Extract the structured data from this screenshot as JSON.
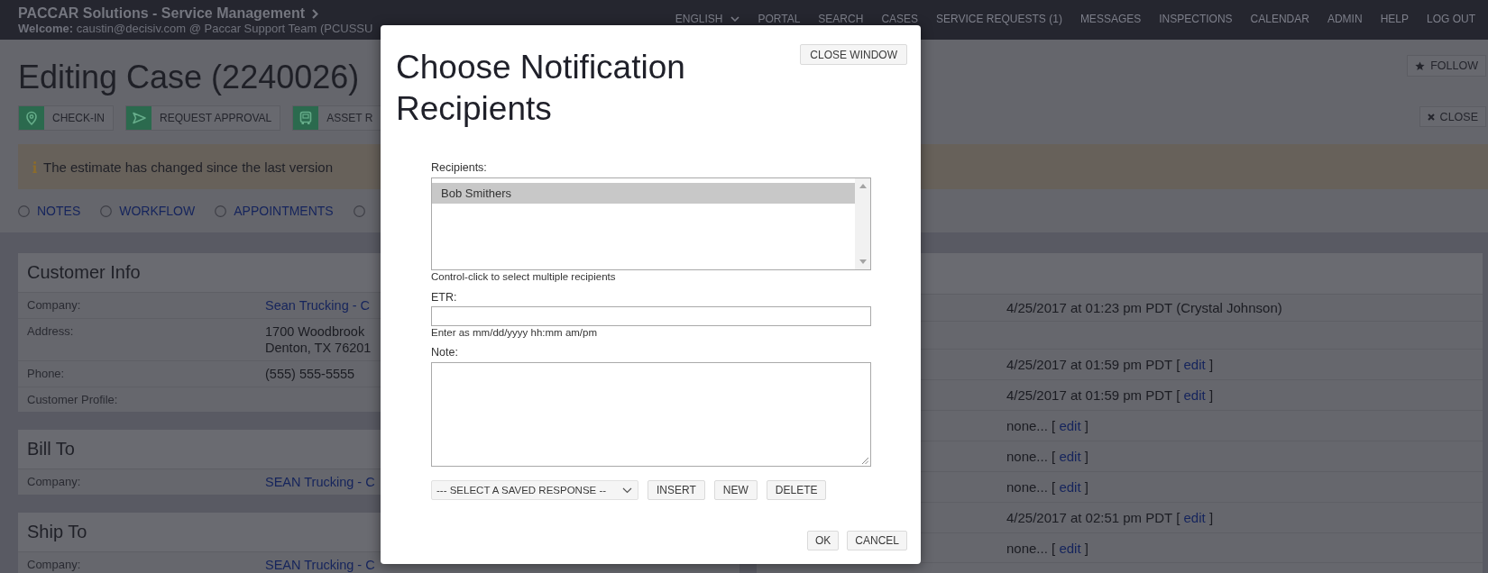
{
  "header": {
    "title": "PACCAR Solutions - Service Management",
    "welcome": "**Welcome:** caustin@decisiv.com @ Paccar Support Team (PCUSSU"
  },
  "nav": [
    {
      "label": "ENGLISH",
      "kind": "dropdown"
    },
    {
      "label": "PORTAL",
      "kind": "link"
    },
    {
      "label": "SEARCH",
      "kind": "link"
    },
    {
      "label": "CASES",
      "kind": "link"
    },
    {
      "label": "SERVICE REQUESTS (1)",
      "kind": "link"
    },
    {
      "label": "MESSAGES",
      "kind": "link"
    },
    {
      "label": "INSPECTIONS",
      "kind": "link"
    },
    {
      "label": "CALENDAR",
      "kind": "link"
    },
    {
      "label": "ADMIN",
      "kind": "link"
    },
    {
      "label": "HELP",
      "kind": "link"
    },
    {
      "label": "LOG OUT",
      "kind": "link"
    }
  ],
  "page": {
    "title": "Editing Case (2240026)",
    "actions": [
      "CHECK-IN",
      "REQUEST APPROVAL",
      "ASSET R"
    ],
    "follow_button": "FOLLOW",
    "close_button": "CLOSE"
  },
  "alert": {
    "text": "The estimate has changed since the last version"
  },
  "tabs": [
    {
      "label": "NOTES",
      "selected": false
    },
    {
      "label": "WORKFLOW",
      "selected": false
    },
    {
      "label": "APPOINTMENTS",
      "selected": false
    },
    {
      "selected": false
    }
  ],
  "panels": [
    {
      "title": "Customer Info",
      "rows": [
        {
          "label": "Company:",
          "kind": "link",
          "value": "Sean Trucking - C"
        },
        {
          "label": "Address:",
          "kind": "text",
          "value": "1700 Woodbrook\nDenton, TX 76201"
        },
        {
          "label": "Phone:",
          "kind": "text",
          "value": "(555) 555-5555"
        },
        {
          "label": "Customer Profile:",
          "kind": "text"
        }
      ]
    },
    {
      "title": "Bill To",
      "rows": [
        {
          "label": "Company:",
          "kind": "link",
          "value": "SEAN Trucking - C"
        }
      ]
    },
    {
      "title": "Ship To",
      "rows": [
        {
          "label": "Company:",
          "kind": "link",
          "value": "SEAN Trucking - C"
        }
      ]
    }
  ],
  "side_panel": {
    "rows": [
      {
        "kind": "text",
        "text": "4/25/2017 at 01:23 pm PDT (Crystal Johnson)"
      },
      {
        "kind": "empty"
      },
      {
        "kind": "editable",
        "text": "4/25/2017 at 01:59 pm PDT [",
        "link": "edit",
        "after": "]"
      },
      {
        "kind": "editable",
        "text": "4/25/2017 at 01:59 pm PDT [",
        "link": "edit",
        "after": "]"
      },
      {
        "kind": "editable",
        "text": "none... [",
        "link": "edit",
        "after": "]"
      },
      {
        "kind": "editable",
        "text": "none... [",
        "link": "edit",
        "after": "]"
      },
      {
        "kind": "editable",
        "text": "none... [",
        "link": "edit",
        "after": "]"
      },
      {
        "kind": "editable",
        "text": "4/25/2017 at 02:51 pm PDT [",
        "link": "edit",
        "after": "]"
      },
      {
        "kind": "editable",
        "text": "none... [",
        "link": "edit",
        "after": "]"
      }
    ]
  },
  "dialog": {
    "title": "Choose Notification Recipients",
    "close_button": "CLOSE WINDOW",
    "recipients": {
      "label": "Recipients:",
      "options": [
        {
          "label": "Bob Smithers",
          "selected": true
        }
      ],
      "hint": "Control-click to select multiple recipients"
    },
    "etr": {
      "label": "ETR:",
      "hint": "Enter as mm/dd/yyyy hh:mm am/pm"
    },
    "note": {
      "label": "Note:"
    },
    "saved_response": {
      "value": "--- SELECT A SAVED RESPONSE --"
    },
    "response_buttons": [
      "INSERT",
      "NEW",
      "DELETE"
    ],
    "buttons": [
      "OK",
      "CANCEL"
    ]
  }
}
